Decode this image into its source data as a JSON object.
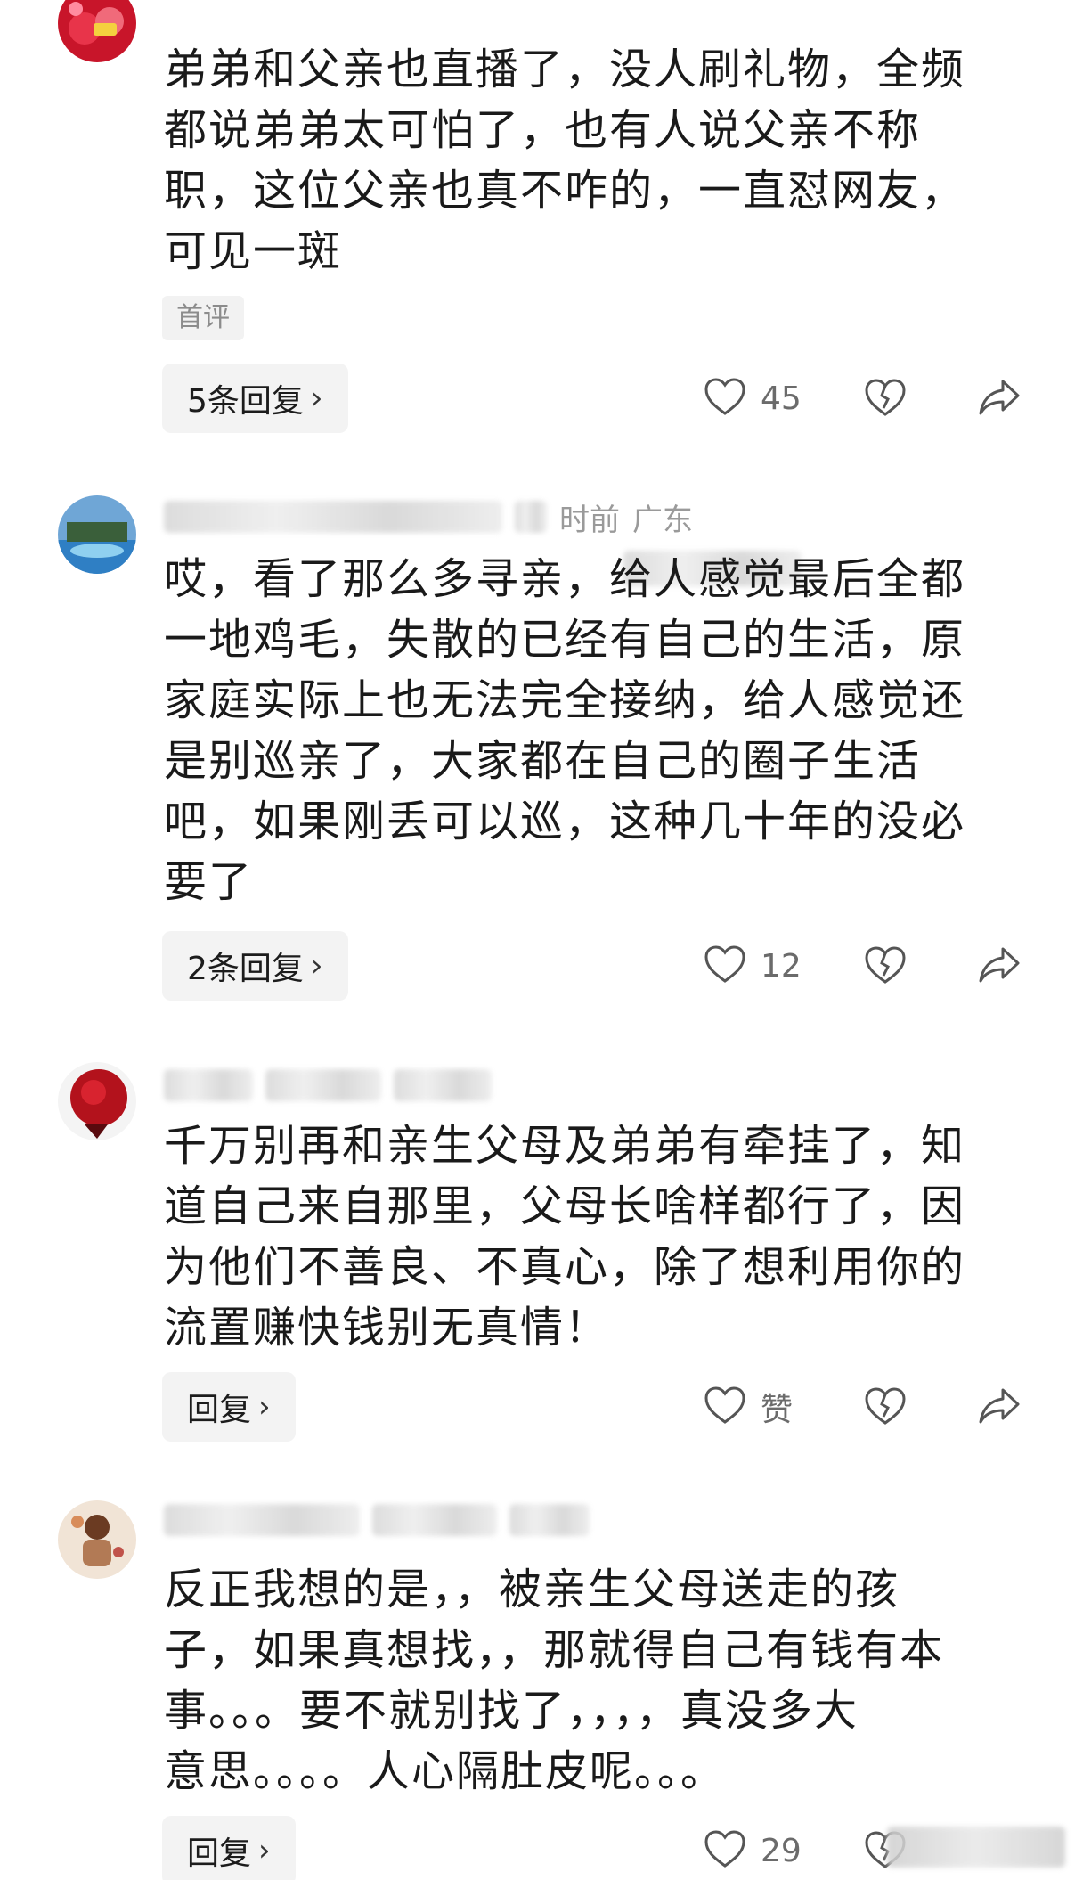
{
  "comments": [
    {
      "meta_location": "",
      "meta_time": "",
      "text": "弟弟和父亲也直播了，没人刷礼物，全频\n都说弟弟太可怕了，也有人说父亲不称\n职，这位父亲也真不咋的，一直怼网友，\n可见一斑",
      "tag": "首评",
      "reply_label": "5条回复",
      "like_count": "45"
    },
    {
      "meta_time": "时前",
      "meta_location": "广东",
      "text": "哎，看了那么多寻亲，给人感觉最后全都\n一地鸡毛，失散的已经有自己的生活，原\n家庭实际上也无法完全接纳，给人感觉还\n是别巡亲了，大家都在自己的圈子生活\n吧，如果刚丢可以巡，这种几十年的没必\n要了",
      "reply_label": "2条回复",
      "like_count": "12"
    },
    {
      "text": "千万别再和亲生父母及弟弟有牵挂了，知\n道自己来自那里，父母长啥样都行了，因\n为他们不善良、不真心，除了想利用你的\n流置赚快钱别无真情！",
      "reply_label": "回复",
      "like_count": "赞"
    },
    {
      "text": "反正我想的是，，被亲生父母送走的孩\n子，如果真想找，，那就得自己有钱有本\n事。。。要不就别找了，，，，真没多大\n意思。。。。人心隔肚皮呢。。。",
      "reply_label": "回复",
      "like_count": "29"
    }
  ],
  "icons": {
    "like": "heart-outline-icon",
    "dislike": "broken-heart-icon",
    "share": "share-arrow-icon",
    "chevron": "chevron-right-icon"
  },
  "colors": {
    "text": "#1a1a1a",
    "muted": "#9a9a9a",
    "button_bg": "#f3f3f3",
    "icon": "#555555"
  }
}
